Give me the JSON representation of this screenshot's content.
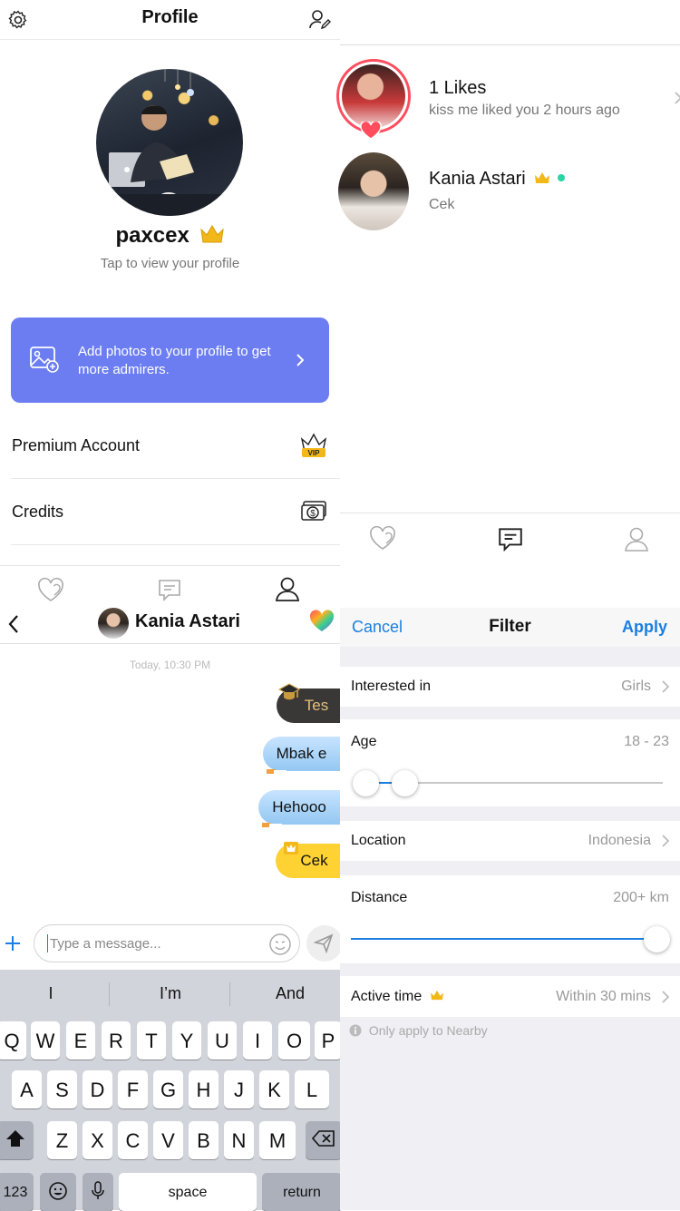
{
  "profile": {
    "title": "Profile",
    "username": "paxcex",
    "tap_hint": "Tap to view your profile",
    "banner_text": "Add photos to your profile to get more admirers.",
    "rows": [
      {
        "label": "Premium Account",
        "badge": "VIP"
      },
      {
        "label": "Credits"
      }
    ]
  },
  "likes": {
    "items": [
      {
        "title": "1 Likes",
        "subtitle": "kiss me liked you 2 hours ago"
      },
      {
        "title": "Kania Astari",
        "subtitle": "Cek"
      }
    ]
  },
  "chat": {
    "contact_name": "Kania Astari",
    "timestamp": "Today, 10:30 PM",
    "messages": [
      {
        "text": "Tes",
        "style": "dark"
      },
      {
        "text": "Mbak e",
        "style": "blue"
      },
      {
        "text": "Hehooo",
        "style": "blue"
      },
      {
        "text": "Cek",
        "style": "yellow"
      }
    ],
    "input_placeholder": "Type a message...",
    "suggestions": [
      "I",
      "I’m",
      "And"
    ],
    "keyboard": {
      "row1": [
        "Q",
        "W",
        "E",
        "R",
        "T",
        "Y",
        "U",
        "I",
        "O",
        "P"
      ],
      "row2": [
        "A",
        "S",
        "D",
        "F",
        "G",
        "H",
        "J",
        "K",
        "L"
      ],
      "row3": [
        "Z",
        "X",
        "C",
        "V",
        "B",
        "N",
        "M"
      ],
      "num_key": "123",
      "space_key": "space",
      "return_key": "return"
    }
  },
  "filter": {
    "cancel": "Cancel",
    "title": "Filter",
    "apply": "Apply",
    "interested_label": "Interested in",
    "interested_value": "Girls",
    "age_label": "Age",
    "age_value": "18 - 23",
    "age_range": [
      18,
      23
    ],
    "location_label": "Location",
    "location_value": "Indonesia",
    "distance_label": "Distance",
    "distance_value": "200+ km",
    "distance_fraction": 1.0,
    "active_label": "Active time",
    "active_value": "Within 30 mins",
    "note": "Only apply to Nearby"
  },
  "colors": {
    "accent_blue": "#1a7fe0",
    "banner": "#6b7df0",
    "online": "#2bd4a4",
    "crown": "#f2b718"
  }
}
